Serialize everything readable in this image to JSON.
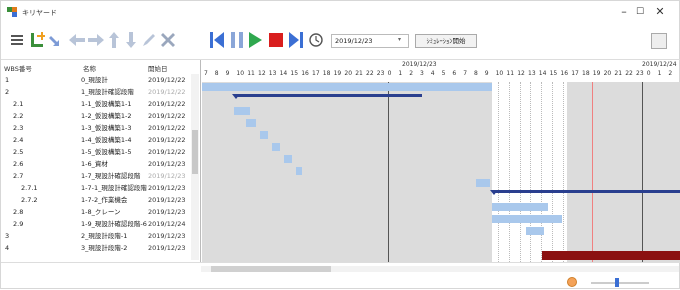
{
  "window": {
    "title": "キリヤード",
    "minimize": "–",
    "maximize": "☐",
    "close": "✕"
  },
  "toolbar": {
    "date_value": "2019/12/23",
    "date_dropdown": "▾",
    "simulation_label": "ｼﾐｭﾚｰｼｮﾝ開始",
    "icons": [
      "menu-icon",
      "add-task-icon",
      "link-icon",
      "arrow-left-icon",
      "arrow-right-icon",
      "arrow-up-icon",
      "arrow-down-icon",
      "pencil-icon",
      "delete-icon",
      "skip-start-icon",
      "pause-icon",
      "play-icon",
      "stop-icon",
      "skip-end-icon",
      "clock-icon"
    ]
  },
  "columns": {
    "wbs": "WBS番号",
    "name": "名称",
    "start": "開始日"
  },
  "rows": [
    {
      "wbs": "1",
      "name": "0_現設計",
      "date": "2019/12/22",
      "dim": false
    },
    {
      "wbs": "2",
      "name": "1_現設計確認段階",
      "date": "2019/12/22",
      "dim": true
    },
    {
      "wbs": "2.1",
      "name": "1-1_仮設構築1-1",
      "date": "2019/12/22",
      "dim": false
    },
    {
      "wbs": "2.2",
      "name": "1-2_仮設構築1-2",
      "date": "2019/12/22",
      "dim": false
    },
    {
      "wbs": "2.3",
      "name": "1-3_仮設構築1-3",
      "date": "2019/12/22",
      "dim": false
    },
    {
      "wbs": "2.4",
      "name": "1-4_仮設構築1-4",
      "date": "2019/12/22",
      "dim": false
    },
    {
      "wbs": "2.5",
      "name": "1-5_仮設構築1-5",
      "date": "2019/12/22",
      "dim": false
    },
    {
      "wbs": "2.6",
      "name": "1-6_資材",
      "date": "2019/12/23",
      "dim": false
    },
    {
      "wbs": "2.7",
      "name": "1-7_現設計確認段階",
      "date": "2019/12/23",
      "dim": true
    },
    {
      "wbs": "2.7.1",
      "name": "1-7-1_現設計確認段階",
      "date": "2019/12/23",
      "dim": false
    },
    {
      "wbs": "2.7.2",
      "name": "1-7-2_作業機会",
      "date": "2019/12/23",
      "dim": false
    },
    {
      "wbs": "2.8",
      "name": "1-8_クレーン",
      "date": "2019/12/23",
      "dim": false
    },
    {
      "wbs": "2.9",
      "name": "1-9_現設計確認段階-6",
      "date": "2019/12/24",
      "dim": false
    },
    {
      "wbs": "3",
      "name": "2_現設計段階-1",
      "date": "2019/12/23",
      "dim": false
    },
    {
      "wbs": "4",
      "name": "3_現設計段階-2",
      "date": "2019/12/23",
      "dim": false
    }
  ],
  "timeline": {
    "day1": "2019/12/22",
    "day2": "2019/12/23",
    "day3": "2019/12/24",
    "hours": [
      "7",
      "8",
      "9",
      "10",
      "11",
      "12",
      "13",
      "14",
      "15",
      "16",
      "17",
      "18",
      "19",
      "20",
      "21",
      "22",
      "23",
      "0",
      "1",
      "2",
      "3",
      "4",
      "5",
      "6",
      "7",
      "8",
      "9",
      "10",
      "11",
      "12",
      "13",
      "14",
      "15",
      "16",
      "17",
      "18",
      "19",
      "20",
      "21",
      "22",
      "23",
      "0",
      "1",
      "2"
    ]
  },
  "colors": {
    "accent_blue": "#3b6fd4",
    "bar_light": "#a9c8ec",
    "summary": "#2a3f8f",
    "critical": "#8b1111",
    "shade": "#dcdcdc",
    "today_line": "#f08080"
  }
}
